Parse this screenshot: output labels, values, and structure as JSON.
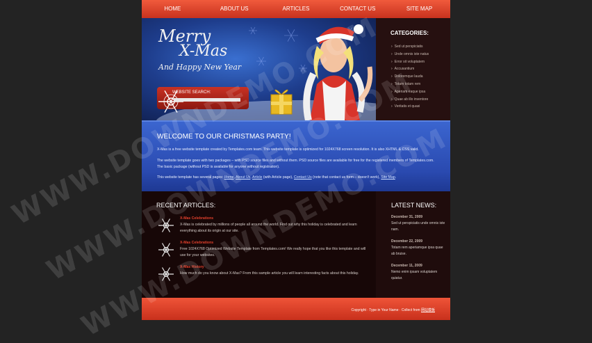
{
  "nav": {
    "items": [
      {
        "label": "HOME"
      },
      {
        "label": "ABOUT US"
      },
      {
        "label": "ARTICLES"
      },
      {
        "label": "CONTACT US"
      },
      {
        "label": "SITE MAP"
      }
    ]
  },
  "banner": {
    "line1": "Merry",
    "line2": "X-Mas",
    "line3": "And Happy New Year",
    "search_label": "WEBSITE SEARCH:",
    "search_value": ""
  },
  "categories": {
    "title": "CATEGORIES:",
    "items": [
      {
        "label": "Sed ut perspiciatis"
      },
      {
        "label": "Unde omnis iste natus"
      },
      {
        "label": "Error sit voluptatem"
      },
      {
        "label": "Accusantium"
      },
      {
        "label": "Doloremque lauda"
      },
      {
        "label": "Totam totam rem"
      },
      {
        "label": "Aperiam eaque ipsa"
      },
      {
        "label": "Quae ab illo inventore"
      },
      {
        "label": "Veritatis et quasi"
      }
    ]
  },
  "welcome": {
    "title": "WELCOME TO OUR CHRISTMAS PARTY!",
    "p1": "X-Mas is a free website template created by Templates.com team. This website template is optimized for 1024X768 screen resolution. It is also XHTML & CSS valid.",
    "p2": "The website template goes with two packages – with PSD source files and without them. PSD source files are available for free for the registered members of Templates.com. The basic package (without PSD is available for anyone without registration).",
    "p3_start": "This website template has several pages: ",
    "link_home": "Home",
    "link_about": "About Us",
    "link_article": "Article",
    "p3_mid": " (with Article page), ",
    "link_contact": "Contact Us",
    "p3_mid2": " (note that contact us form – doesn't work), ",
    "link_sitemap": "Site Map",
    "sep": ", ",
    "end": "."
  },
  "recent": {
    "title": "RECENT ARTICLES:",
    "articles": [
      {
        "title": "X-Mas Celebrations",
        "text": "X-Mas is celebrated by millions of people all around the world. Find out why this holiday is celebrated and learn everything about its origin at our site."
      },
      {
        "title": "X-Mas Celebrations",
        "text": "Free 1024X768 Optimized Website Template from Templates.com! We really hope that you like this template and will use for your websites."
      },
      {
        "title": "X-Mas History",
        "text": "How much do you know about X-Mas? From this sample article you will learn interesting facts about this holiday."
      }
    ]
  },
  "news": {
    "title": "LATEST NEWS:",
    "items": [
      {
        "date": "December 31, 2009",
        "text": "Sed ut perspiciatis unde omnis iste nam."
      },
      {
        "date": "December 22, 2009",
        "text": "Totam rem aperiamque ipsa quae ab bruise."
      },
      {
        "date": "December 11, 2009",
        "text": "Nemo enim ipsam voluptatem quiatur."
      }
    ]
  },
  "footer": {
    "text": "Copyright · Type in Your Name · Collect from ",
    "link": "网站模板"
  },
  "watermark": {
    "text": "WWW.DOWNDEMO.COM"
  }
}
